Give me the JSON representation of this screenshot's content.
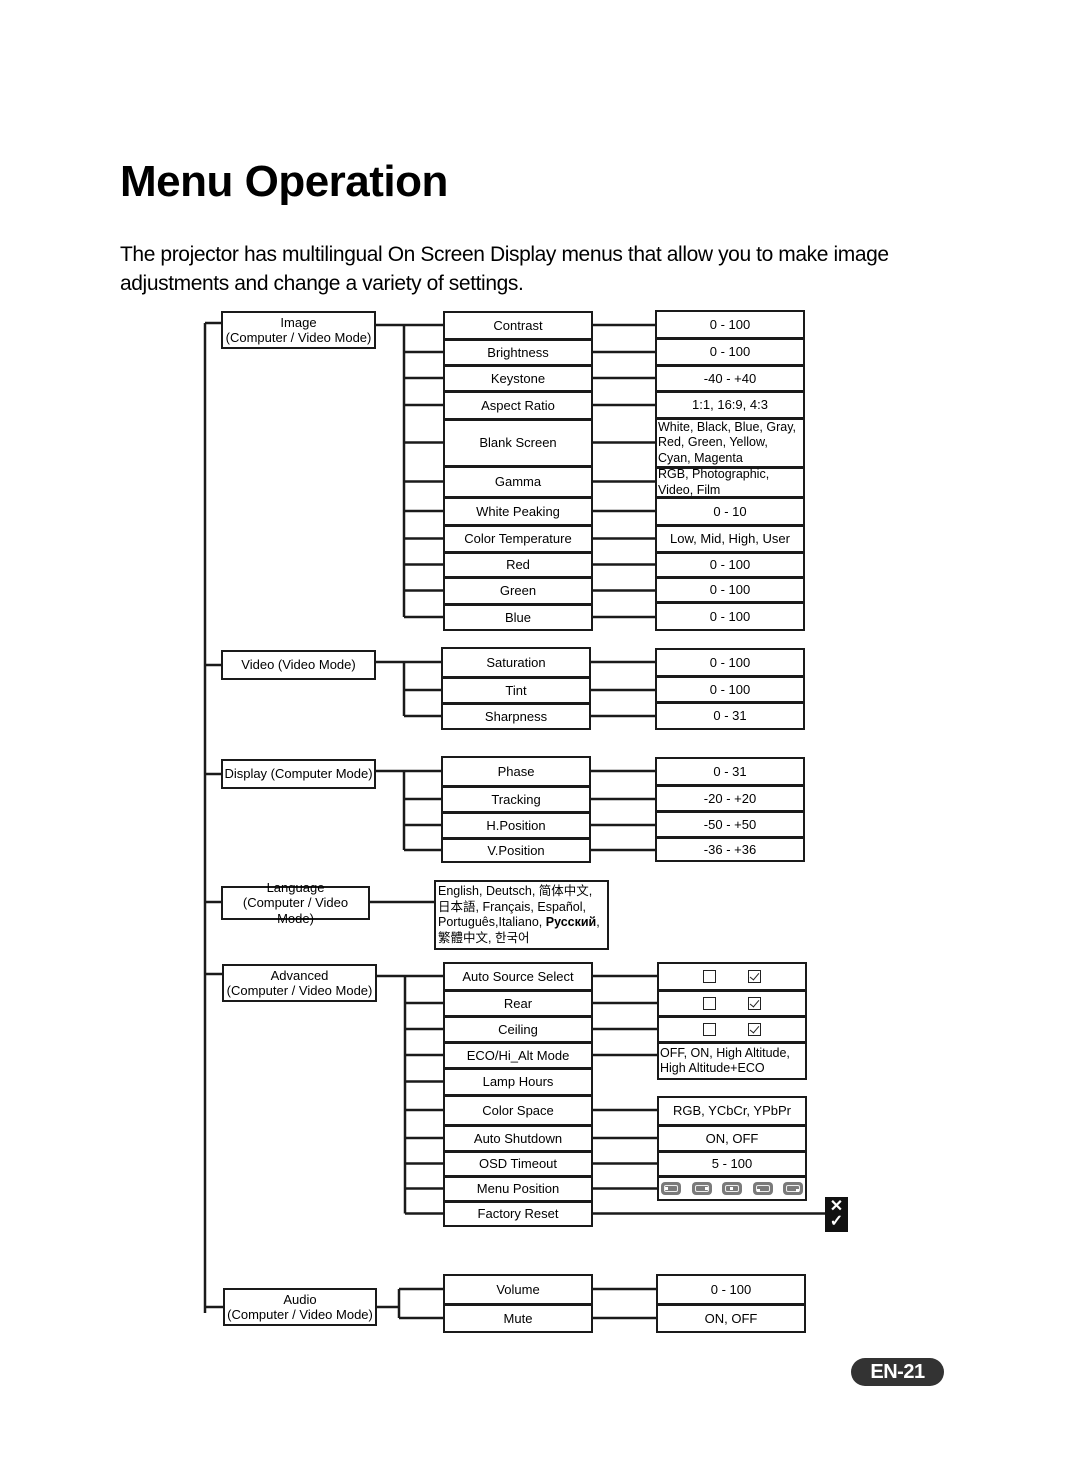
{
  "page": {
    "title": "Menu Operation",
    "intro": "The projector has multilingual On Screen Display menus that allow you to make image adjustments and change a variety of settings.",
    "page_number": "EN-21"
  },
  "menu_tree": [
    {
      "id": "image",
      "label_lines": [
        "Image",
        "(Computer / Video Mode)"
      ],
      "items": [
        {
          "label": "Contrast",
          "value": "0 - 100"
        },
        {
          "label": "Brightness",
          "value": "0 - 100"
        },
        {
          "label": "Keystone",
          "value": "-40 - +40"
        },
        {
          "label": "Aspect Ratio",
          "value": "1:1, 16:9, 4:3"
        },
        {
          "label": "Blank Screen",
          "value": "White, Black, Blue, Gray, Red, Green, Yellow, Cyan, Magenta"
        },
        {
          "label": "Gamma",
          "value": "RGB, Photographic, Video, Film"
        },
        {
          "label": "White Peaking",
          "value": "0 - 10"
        },
        {
          "label": "Color Temperature",
          "value": "Low, Mid, High, User"
        },
        {
          "label": "Red",
          "value": "0 - 100"
        },
        {
          "label": "Green",
          "value": "0 - 100"
        },
        {
          "label": "Blue",
          "value": "0 - 100"
        }
      ]
    },
    {
      "id": "video",
      "label_lines": [
        "Video (Video Mode)"
      ],
      "items": [
        {
          "label": "Saturation",
          "value": "0 - 100"
        },
        {
          "label": "Tint",
          "value": "0 - 100"
        },
        {
          "label": "Sharpness",
          "value": "0 - 31"
        }
      ]
    },
    {
      "id": "display",
      "label_lines": [
        "Display (Computer Mode)"
      ],
      "items": [
        {
          "label": "Phase",
          "value": "0 - 31"
        },
        {
          "label": "Tracking",
          "value": "-20 - +20"
        },
        {
          "label": "H.Position",
          "value": "-50 - +50"
        },
        {
          "label": "V.Position",
          "value": "-36 - +36"
        }
      ]
    },
    {
      "id": "language",
      "label_lines": [
        "Language",
        "(Computer / Video Mode)"
      ],
      "options": [
        "English",
        "Deutsch",
        "简体中文",
        "日本語",
        "Français",
        "Español",
        "Português",
        "Italiano",
        "Русский",
        "繁體中文",
        "한국어"
      ]
    },
    {
      "id": "advanced",
      "label_lines": [
        "Advanced",
        "(Computer / Video Mode)"
      ],
      "items": [
        {
          "label": "Auto Source Select",
          "value_type": "checkbox",
          "states": [
            "off-icon",
            "on-icon"
          ]
        },
        {
          "label": "Rear",
          "value_type": "checkbox",
          "states": [
            "off-icon",
            "on-icon"
          ]
        },
        {
          "label": "Ceiling",
          "value_type": "checkbox",
          "states": [
            "off-icon",
            "on-icon"
          ]
        },
        {
          "label": "ECO/Hi_Alt Mode",
          "value": "OFF, ON, High Altitude, High Altitude+ECO"
        },
        {
          "label": "Lamp Hours"
        },
        {
          "label": "Color Space",
          "value": "RGB, YCbCr, YPbPr"
        },
        {
          "label": "Auto Shutdown",
          "value": "ON, OFF"
        },
        {
          "label": "OSD Timeout",
          "value": "5 - 100"
        },
        {
          "label": "Menu Position",
          "value_type": "icons",
          "icons": [
            "top-left-position-icon",
            "top-right-position-icon",
            "center-position-icon",
            "bottom-left-position-icon",
            "bottom-right-position-icon"
          ]
        },
        {
          "label": "Factory Reset",
          "value_type": "icon",
          "icon": "cancel-confirm-icon",
          "glyphs": [
            "✕",
            "✓"
          ]
        }
      ]
    },
    {
      "id": "audio",
      "label_lines": [
        "Audio",
        "(Computer / Video Mode)"
      ],
      "items": [
        {
          "label": "Volume",
          "value": "0 - 100"
        },
        {
          "label": "Mute",
          "value": "ON, OFF"
        }
      ]
    }
  ]
}
